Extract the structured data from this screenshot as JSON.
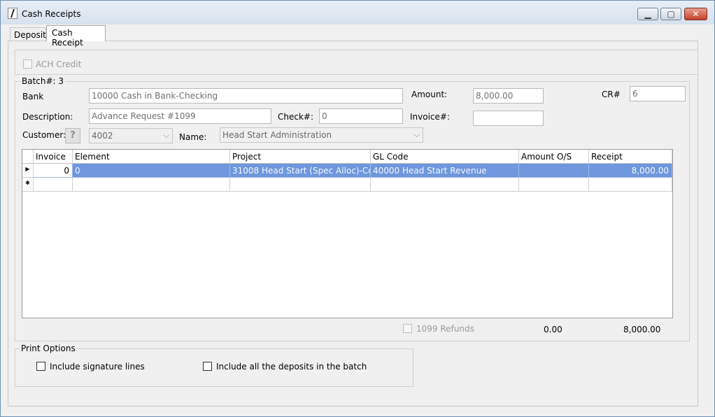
{
  "window": {
    "title": "Cash Receipts"
  },
  "tabs": [
    {
      "label": "Deposit"
    },
    {
      "label": "Cash Receipt"
    }
  ],
  "form": {
    "ach_credit": "ACH Credit",
    "batch_legend": "Batch#: 3",
    "bank_label": "Bank",
    "bank_value": "10000 Cash in Bank-Checking",
    "amount_label": "Amount:",
    "amount_value": "8,000.00",
    "cr_label": "CR#",
    "cr_value": "6",
    "description_label": "Description:",
    "description_value": "Advance Request #1099",
    "check_label": "Check#:",
    "check_value": "0",
    "invoice_label": "Invoice#:",
    "invoice_value": "",
    "customer_label": "Customer:",
    "help_glyph": "?",
    "customer_value": "4002",
    "name_label": "Name:",
    "name_value": "Head Start Administration"
  },
  "grid": {
    "columns": [
      "Invoice",
      "Element",
      "Project",
      "GL Code",
      "Amount O/S",
      "Receipt"
    ],
    "rows": [
      {
        "marker": "▶",
        "invoice": "0",
        "element": "0",
        "project": "31008 Head Start (Spec Alloc)-Cost R...",
        "gl_code": "40000 Head Start Revenue",
        "amount_os": "",
        "receipt": "8,000.00"
      }
    ],
    "new_row_marker": "✱"
  },
  "totals": {
    "refunds_label": "1099 Refunds",
    "amount_os_total": "0.00",
    "receipt_total": "8,000.00"
  },
  "print_options": {
    "legend": "Print Options",
    "signature_lines": "Include signature lines",
    "all_deposits": "Include all the deposits in the batch"
  }
}
